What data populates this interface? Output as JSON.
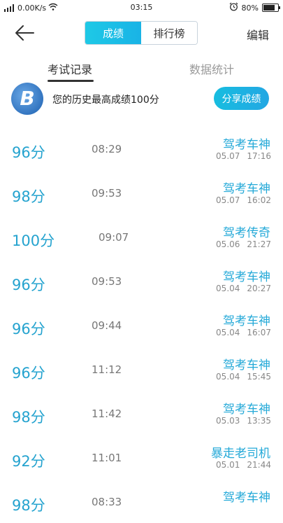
{
  "status_bar": {
    "network_speed": "0.00K/s",
    "time": "03:15",
    "battery": "80%",
    "battery_level": 0.8
  },
  "nav": {
    "seg_scores": "成绩",
    "seg_ranking": "排行榜",
    "edit": "编辑"
  },
  "tabs": {
    "records": "考试记录",
    "stats": "数据统计"
  },
  "best": {
    "text": "您的历史最高成绩100分",
    "share": "分享成绩",
    "avatar_letter": "B"
  },
  "records": [
    {
      "score": "96分",
      "duration": "08:29",
      "title": "驾考车神",
      "date": "05.07",
      "time": "17:16"
    },
    {
      "score": "98分",
      "duration": "09:53",
      "title": "驾考车神",
      "date": "05.07",
      "time": "16:02"
    },
    {
      "score": "100分",
      "duration": "09:07",
      "title": "驾考传奇",
      "date": "05.06",
      "time": "21:27"
    },
    {
      "score": "96分",
      "duration": "09:53",
      "title": "驾考车神",
      "date": "05.04",
      "time": "20:27"
    },
    {
      "score": "96分",
      "duration": "09:44",
      "title": "驾考车神",
      "date": "05.04",
      "time": "16:07"
    },
    {
      "score": "96分",
      "duration": "11:12",
      "title": "驾考车神",
      "date": "05.04",
      "time": "15:45"
    },
    {
      "score": "98分",
      "duration": "11:42",
      "title": "驾考车神",
      "date": "05.03",
      "time": "13:35"
    },
    {
      "score": "92分",
      "duration": "11:01",
      "title": "暴走老司机",
      "date": "05.01",
      "time": "21:44"
    },
    {
      "score": "98分",
      "duration": "08:33",
      "title": "驾考车神",
      "date": "",
      "time": ""
    }
  ]
}
